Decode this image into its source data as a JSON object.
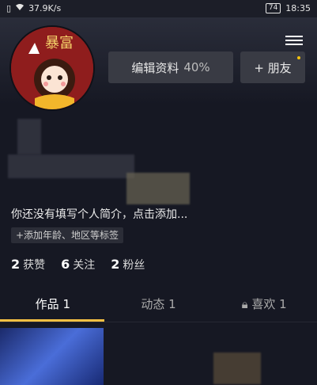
{
  "status_bar": {
    "network_speed": "37.9K/s",
    "battery": "74",
    "time": "18:35"
  },
  "avatar": {
    "badge_text": "暴富"
  },
  "buttons": {
    "edit_profile": "编辑资料",
    "edit_profile_pct": "40%",
    "add_friend": "+ 朋友"
  },
  "profile": {
    "bio_placeholder": "你还没有填写个人简介，点击添加...",
    "add_tags": "+添加年龄、地区等标签"
  },
  "stats": {
    "likes": {
      "count": "2",
      "label": "获赞"
    },
    "following": {
      "count": "6",
      "label": "关注"
    },
    "followers": {
      "count": "2",
      "label": "粉丝"
    }
  },
  "tabs": [
    {
      "label": "作品 1"
    },
    {
      "label": "动态 1"
    },
    {
      "label": "喜欢 1"
    }
  ],
  "colors": {
    "background": "#161823",
    "accent": "#f6c043"
  }
}
